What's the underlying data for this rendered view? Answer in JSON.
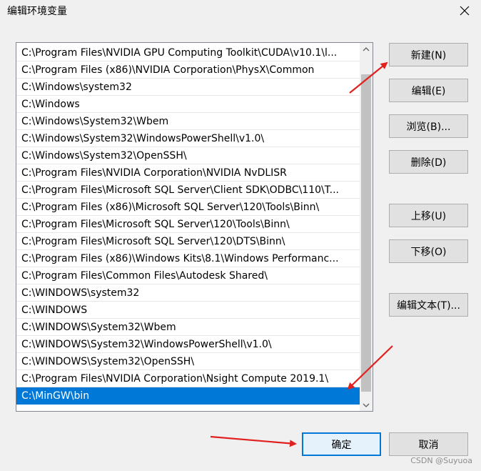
{
  "dialog": {
    "title": "编辑环境变量",
    "close_glyph": "✕"
  },
  "paths": [
    "C:\\Program Files\\NVIDIA GPU Computing Toolkit\\CUDA\\v10.1\\l...",
    "C:\\Program Files (x86)\\NVIDIA Corporation\\PhysX\\Common",
    "C:\\Windows\\system32",
    "C:\\Windows",
    "C:\\Windows\\System32\\Wbem",
    "C:\\Windows\\System32\\WindowsPowerShell\\v1.0\\",
    "C:\\Windows\\System32\\OpenSSH\\",
    "C:\\Program Files\\NVIDIA Corporation\\NVIDIA NvDLISR",
    "C:\\Program Files\\Microsoft SQL Server\\Client SDK\\ODBC\\110\\T...",
    "C:\\Program Files (x86)\\Microsoft SQL Server\\120\\Tools\\Binn\\",
    "C:\\Program Files\\Microsoft SQL Server\\120\\Tools\\Binn\\",
    "C:\\Program Files\\Microsoft SQL Server\\120\\DTS\\Binn\\",
    "C:\\Program Files (x86)\\Windows Kits\\8.1\\Windows Performanc...",
    "C:\\Program Files\\Common Files\\Autodesk Shared\\",
    "C:\\WINDOWS\\system32",
    "C:\\WINDOWS",
    "C:\\WINDOWS\\System32\\Wbem",
    "C:\\WINDOWS\\System32\\WindowsPowerShell\\v1.0\\",
    "C:\\WINDOWS\\System32\\OpenSSH\\",
    "C:\\Program Files\\NVIDIA Corporation\\Nsight Compute 2019.1\\",
    "C:\\MinGW\\bin"
  ],
  "selected_index": 20,
  "buttons": {
    "new": "新建(N)",
    "edit": "编辑(E)",
    "browse": "浏览(B)...",
    "delete": "删除(D)",
    "move_up": "上移(U)",
    "move_down": "下移(O)",
    "edit_text": "编辑文本(T)...",
    "ok": "确定",
    "cancel": "取消"
  },
  "watermark": "CSDN @Suyuoa",
  "colors": {
    "selection": "#0078d7",
    "annotation_arrow": "#e0211f"
  }
}
